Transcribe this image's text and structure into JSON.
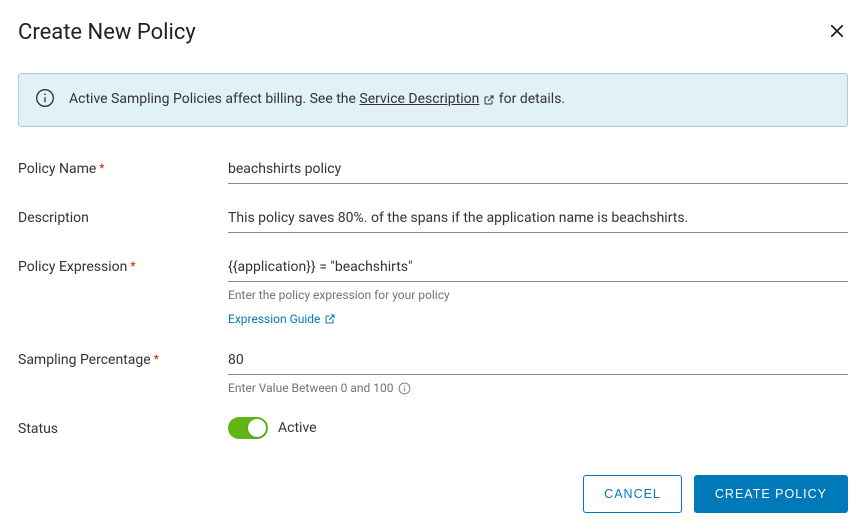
{
  "title": "Create New Policy",
  "banner": {
    "prefix": "Active Sampling Policies affect billing. See the ",
    "link": "Service Description",
    "suffix": " for details."
  },
  "fields": {
    "policyName": {
      "label": "Policy Name",
      "value": "beachshirts policy"
    },
    "description": {
      "label": "Description",
      "value": "This policy saves 80%. of the spans if the application name is beachshirts."
    },
    "policyExpression": {
      "label": "Policy Expression",
      "value": "{{application}} = \"beachshirts\"",
      "helper": "Enter the policy expression for your policy",
      "guideLink": "Expression Guide"
    },
    "samplingPercentage": {
      "label": "Sampling Percentage",
      "value": "80",
      "helper": "Enter Value Between 0 and 100"
    },
    "status": {
      "label": "Status",
      "stateLabel": "Active"
    }
  },
  "buttons": {
    "cancel": "Cancel",
    "create": "Create Policy"
  }
}
